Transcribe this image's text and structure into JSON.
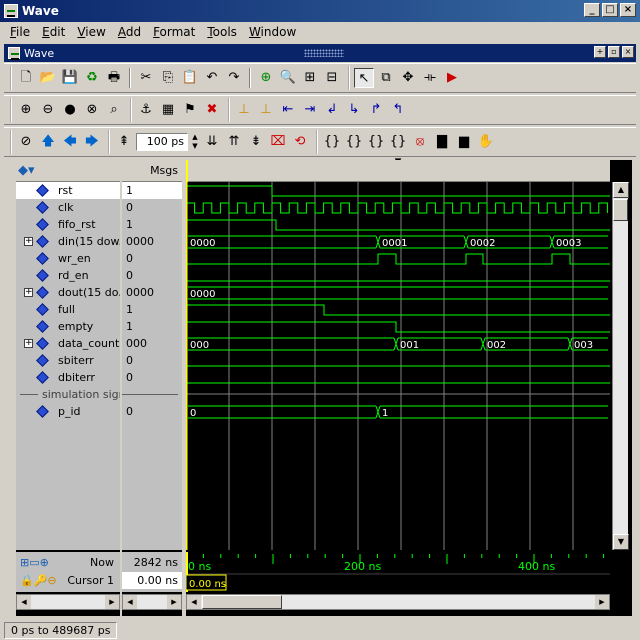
{
  "window": {
    "title": "Wave",
    "minimize": "_",
    "maximize": "□",
    "close": "×"
  },
  "menu": [
    {
      "first": "F",
      "rest": "ile"
    },
    {
      "first": "E",
      "rest": "dit"
    },
    {
      "first": "V",
      "rest": "iew"
    },
    {
      "first": "A",
      "rest": "dd"
    },
    {
      "first": "F",
      "rest": "ormat"
    },
    {
      "first": "T",
      "rest": "ools"
    },
    {
      "first": "W",
      "rest": "indow"
    }
  ],
  "subwindow": {
    "title": "Wave"
  },
  "toolbar": {
    "zoom_value": "100 ps"
  },
  "columns": {
    "msgs": "Msgs"
  },
  "signals": [
    {
      "name": "rst",
      "value": "1",
      "bus": false
    },
    {
      "name": "clk",
      "value": "0",
      "bus": false
    },
    {
      "name": "fifo_rst",
      "value": "1",
      "bus": false
    },
    {
      "name": "din(15 dow...",
      "value": "0000",
      "bus": true
    },
    {
      "name": "wr_en",
      "value": "0",
      "bus": false
    },
    {
      "name": "rd_en",
      "value": "0",
      "bus": false
    },
    {
      "name": "dout(15 do...",
      "value": "0000",
      "bus": true
    },
    {
      "name": "full",
      "value": "1",
      "bus": false
    },
    {
      "name": "empty",
      "value": "1",
      "bus": false
    },
    {
      "name": "data_count",
      "value": "000",
      "bus": true
    },
    {
      "name": "sbiterr",
      "value": "0",
      "bus": false
    },
    {
      "name": "dbiterr",
      "value": "0",
      "bus": false
    }
  ],
  "divider": {
    "label": "simulation signals"
  },
  "extra_signals": [
    {
      "name": "p_id",
      "value": "0"
    }
  ],
  "bus_values": {
    "din": [
      "0000",
      "0001",
      "0002",
      "0003"
    ],
    "dout": [
      "0000"
    ],
    "data_count": [
      "000",
      "001",
      "002",
      "003"
    ],
    "p_id": [
      "0",
      "1"
    ]
  },
  "now": {
    "label": "Now",
    "value": "2842 ns"
  },
  "cursor": {
    "label": "Cursor 1",
    "value": "0.00 ns",
    "marker": "0.00 ns"
  },
  "time_axis": {
    "ticks": [
      "0 ns",
      "200 ns",
      "400 ns"
    ]
  },
  "status": {
    "range": "0 ps to 489687 ps"
  },
  "colors": {
    "wave": "#00ff00",
    "cursor": "#ffff00",
    "grid": "#808080"
  }
}
